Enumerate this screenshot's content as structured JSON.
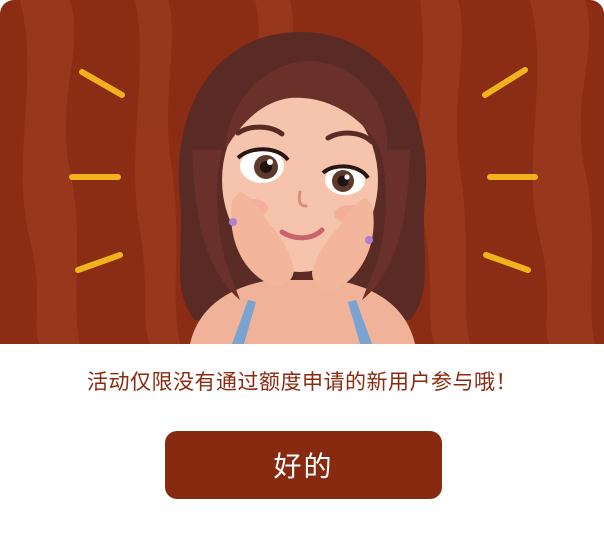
{
  "dialog": {
    "message": "活动仅限没有通过额度申请的新用户参与哦！",
    "confirm_label": "好的"
  },
  "colors": {
    "banner_bg": "#8b2c14",
    "stripe": "#9a3a1e",
    "button_bg": "#882a10",
    "message_text": "#8a2a10",
    "accent_rays": "#f2b21c"
  },
  "banner": {
    "illustration": "cartoon-girl-hands-on-cheeks"
  }
}
